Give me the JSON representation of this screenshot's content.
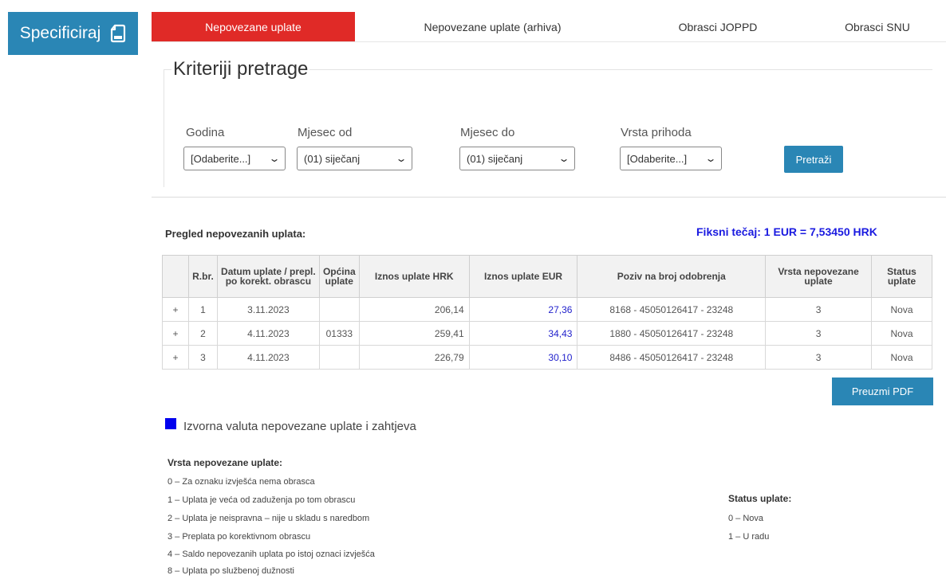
{
  "specify_button": {
    "label": "Specificiraj",
    "icon": "document-icon"
  },
  "tabs": [
    {
      "label": "Nepovezane uplate",
      "active": true
    },
    {
      "label": "Nepovezane uplate (arhiva)",
      "active": false
    },
    {
      "label": "Obrasci JOPPD",
      "active": false
    },
    {
      "label": "Obrasci SNU",
      "active": false
    }
  ],
  "search": {
    "title": "Kriteriji pretrage",
    "fields": [
      {
        "label": "Godina",
        "value": "[Odaberite...]"
      },
      {
        "label": "Mjesec od",
        "value": "(01) siječanj"
      },
      {
        "label": "Mjesec do",
        "value": "(01) siječanj"
      },
      {
        "label": "Vrsta prihoda",
        "value": "[Odaberite...]"
      }
    ],
    "button_label": "Pretraži"
  },
  "overview": {
    "title": "Pregled nepovezanih uplata:",
    "fixed_rate": "Fiksni tečaj: 1 EUR = 7,53450 HRK"
  },
  "table": {
    "headers": [
      "",
      "R.br.",
      "Datum uplate / prepl. po korekt. obrascu",
      "Općina uplate",
      "Iznos uplate HRK",
      "Iznos uplate EUR",
      "Poziv na broj odobrenja",
      "Vrsta nepovezane uplate",
      "Status uplate"
    ],
    "rows": [
      {
        "expand": "+",
        "rbr": "1",
        "date": "3.11.2023",
        "opcina": "",
        "hrk": "206,14",
        "eur": "27,36",
        "poziv": "8168 - 45050126417 - 23248",
        "vrsta": "3",
        "status": "Nova"
      },
      {
        "expand": "+",
        "rbr": "2",
        "date": "4.11.2023",
        "opcina": "01333",
        "hrk": "259,41",
        "eur": "34,43",
        "poziv": "1880 - 45050126417 - 23248",
        "vrsta": "3",
        "status": "Nova"
      },
      {
        "expand": "+",
        "rbr": "3",
        "date": "4.11.2023",
        "opcina": "",
        "hrk": "226,79",
        "eur": "30,10",
        "poziv": "8486 - 45050126417 - 23248",
        "vrsta": "3",
        "status": "Nova"
      }
    ]
  },
  "pdf_button_label": "Preuzmi PDF",
  "legend": {
    "text": "Izvorna valuta nepovezane uplate i zahtjeva",
    "color": "#0000ee"
  },
  "vrsta_legend": {
    "title": "Vrsta nepovezane uplate:",
    "items": [
      "0 – Za oznaku izvješća nema obrasca",
      "1 – Uplata je veća od zaduženja po tom obrascu",
      "2 – Uplata je neispravna – nije u skladu s naredbom",
      "3 – Preplata po korektivnom obrascu",
      "4 – Saldo nepovezanih uplata po istoj oznaci izvješća",
      "8 – Uplata po službenoj dužnosti"
    ]
  },
  "status_legend": {
    "title": "Status uplate:",
    "items": [
      "0 – Nova",
      "1 – U radu"
    ]
  },
  "colors": {
    "primary": "#2a86b5",
    "active_tab": "#e02a27",
    "eur_text": "#2222cc"
  }
}
